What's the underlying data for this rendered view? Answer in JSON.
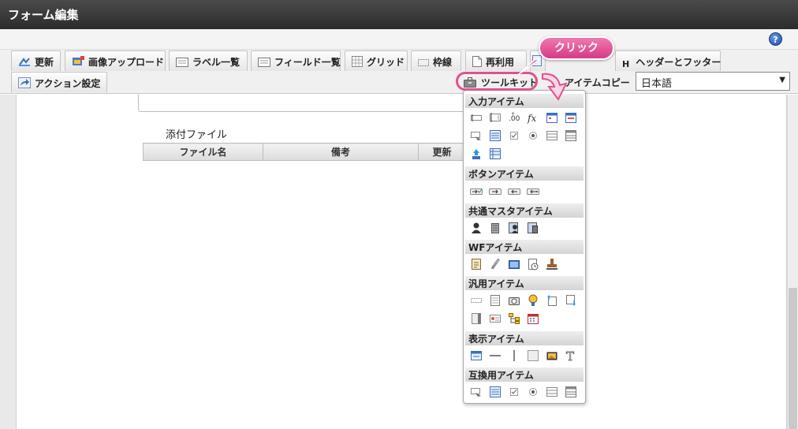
{
  "window": {
    "title": "フォーム編集"
  },
  "toolbar": {
    "update": "更新",
    "image_upload": "画像アップロード",
    "label_list": "ラベル一覧",
    "field_list": "フィールド一覧",
    "grid": "グリッド",
    "frame_line": "枠線",
    "reuse": "再利用",
    "header_footer": "ヘッダーとフッター",
    "header_footer_icon": "H",
    "action_settings": "アクション設定",
    "toolkit": "ツールキット",
    "item_copy": "アイテムコピー",
    "language": "日本語"
  },
  "callout": {
    "text": "クリック"
  },
  "form": {
    "attachment_title": "添付ファイル",
    "columns": [
      "ファイル名",
      "備考",
      "更新"
    ]
  },
  "toolkit_panel": {
    "sections": [
      {
        "label": "入力アイテム",
        "icons": [
          "textbox-icon",
          "textarea-icon",
          "number-icon",
          "formula-icon",
          "date-icon",
          "datetime-icon",
          "select-icon",
          "list-icon",
          "checkbox-icon",
          "radio-icon",
          "listbox-icon",
          "table-icon",
          "upload-icon",
          "grid-icon"
        ]
      },
      {
        "label": "ボタンアイテム",
        "icons": [
          "action-button-icon",
          "next-button-icon",
          "back-button-icon",
          "cancel-button-icon"
        ]
      },
      {
        "label": "共通マスタアイテム",
        "icons": [
          "user-icon",
          "organization-icon",
          "user-search-icon",
          "organization-search-icon"
        ]
      },
      {
        "label": "WFアイテム",
        "icons": [
          "flow-icon",
          "attachment-icon",
          "image-icon",
          "history-icon",
          "stamp-icon"
        ]
      },
      {
        "label": "汎用アイテム",
        "icons": [
          "label-icon",
          "document-icon",
          "camera-icon",
          "map-icon",
          "file-upload-icon",
          "file-download-icon",
          "panel-icon",
          "card-icon",
          "tree-icon",
          "calendar-icon"
        ]
      },
      {
        "label": "表示アイテム",
        "icons": [
          "text-display-icon",
          "horizontal-line-icon",
          "vertical-line-icon",
          "box-icon",
          "picture-icon",
          "text-t-icon"
        ]
      },
      {
        "label": "互換用アイテム",
        "icons": [
          "select-compat-icon",
          "list-compat-icon",
          "checkbox-compat-icon",
          "radio-compat-icon",
          "listbox-compat-icon",
          "table-compat-icon"
        ]
      }
    ]
  },
  "colors": {
    "accent_pink": "#e2508f",
    "titlebar": "#333333"
  }
}
